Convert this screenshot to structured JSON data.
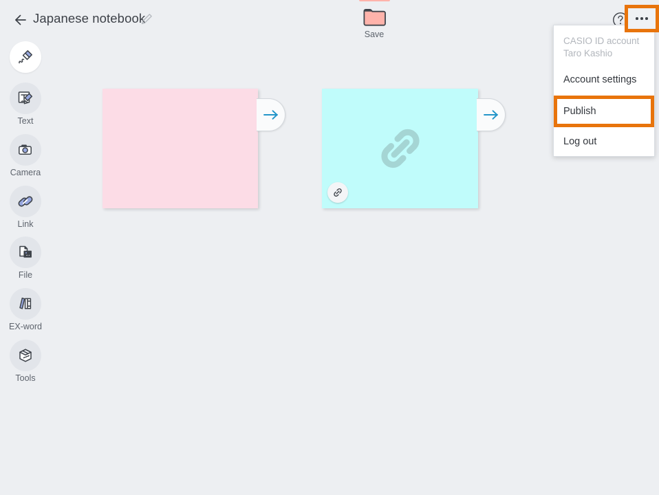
{
  "header": {
    "back_icon": "back-arrow-icon",
    "title": "Japanese notebook",
    "edit_icon": "pencil-edit-icon",
    "help_icon": "help-circle-icon",
    "overflow_icon": "ellipsis-icon"
  },
  "save_tool": {
    "label": "Save",
    "icon": "folder-icon",
    "accent_color": "#ffb3ab"
  },
  "account_menu": {
    "account_label": "CASIO ID account",
    "account_name": "Taro Kashio",
    "items": [
      {
        "label": "Account settings",
        "name": "account-settings"
      },
      {
        "label": "Publish",
        "name": "publish"
      },
      {
        "label": "Log out",
        "name": "log-out"
      }
    ],
    "highlight_color": "#e8740c"
  },
  "tools": [
    {
      "label": "",
      "icon": "pen-icon",
      "name": "pen",
      "active": true
    },
    {
      "label": "Text",
      "icon": "text-icon",
      "name": "text",
      "active": false
    },
    {
      "label": "Camera",
      "icon": "camera-icon",
      "name": "camera",
      "active": false
    },
    {
      "label": "Link",
      "icon": "link-icon",
      "name": "link",
      "active": false
    },
    {
      "label": "File",
      "icon": "file-image-icon",
      "name": "file",
      "active": false
    },
    {
      "label": "EX-word",
      "icon": "books-icon",
      "name": "ex-word",
      "active": false
    },
    {
      "label": "Tools",
      "icon": "toolbox-icon",
      "name": "tools",
      "active": false
    }
  ],
  "canvas": {
    "cards": [
      {
        "name": "pink-note-card",
        "color": "#fcdce6",
        "content": "",
        "center_icon": "",
        "badge_icon": "",
        "arrow_icon": "arrow-right-icon"
      },
      {
        "name": "cyan-link-card",
        "color": "#c0fcfb",
        "content": "",
        "center_icon": "chain-link-icon",
        "badge_icon": "chain-link-badge-icon",
        "arrow_icon": "arrow-right-icon"
      }
    ]
  },
  "colors": {
    "background": "#edeff2",
    "arrow": "#2295c9",
    "accent_orange": "#e8740c"
  }
}
